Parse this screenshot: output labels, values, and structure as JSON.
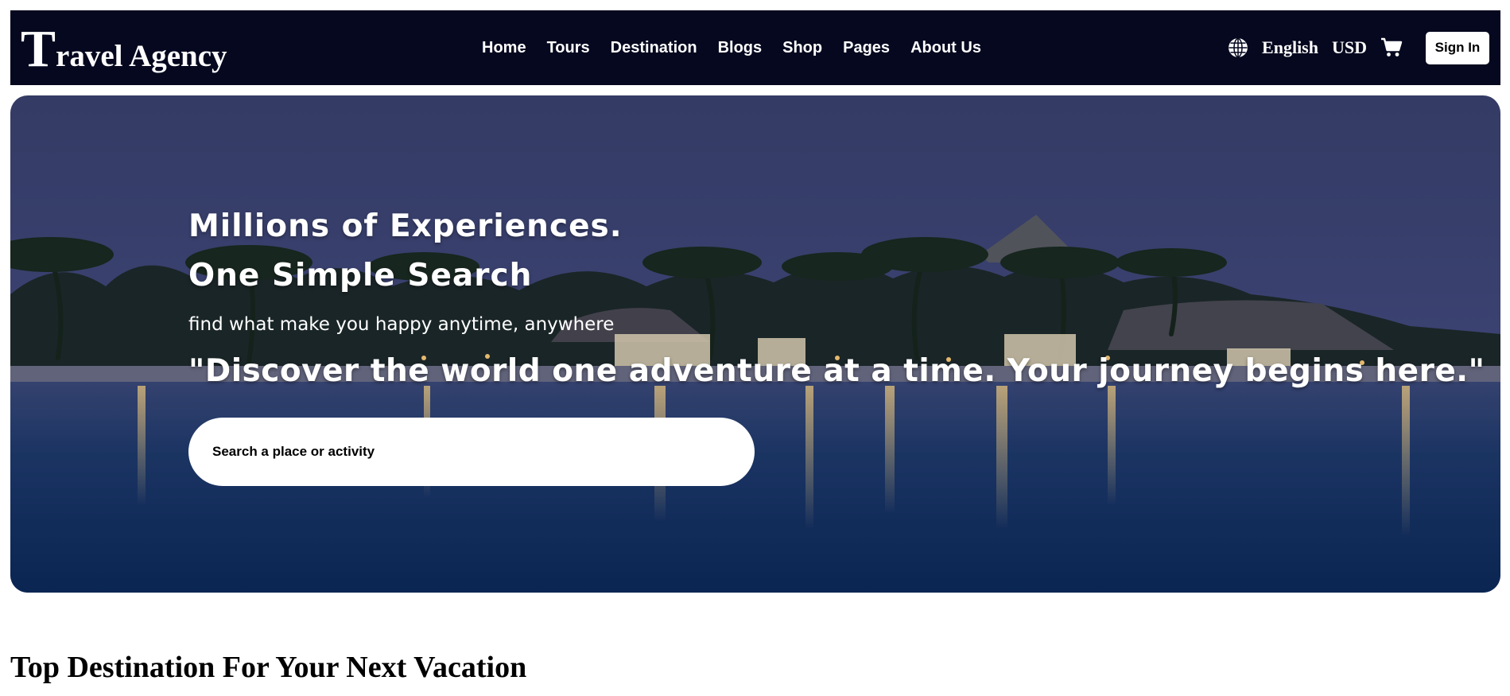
{
  "navbar": {
    "logo_initial": "T",
    "logo_rest": "ravel Agency",
    "links": [
      {
        "label": "Home"
      },
      {
        "label": "Tours"
      },
      {
        "label": "Destination"
      },
      {
        "label": "Blogs"
      },
      {
        "label": "Shop"
      },
      {
        "label": "Pages"
      },
      {
        "label": "About Us"
      }
    ],
    "language": "English",
    "currency": "USD",
    "signin_label": "Sign In",
    "icons": {
      "language": "globe-icon",
      "cart": "cart-icon"
    },
    "background_color": "#05081f"
  },
  "hero": {
    "title_line1": "Millions of Experiences.",
    "title_line2": "One Simple Search",
    "subtitle": "find what make you happy anytime, anywhere",
    "quote": "\"Discover the world one adventure at a time. Your journey begins here.\"",
    "search_placeholder": "Search a place or activity"
  },
  "section": {
    "title": "Top Destination For Your Next Vacation"
  }
}
